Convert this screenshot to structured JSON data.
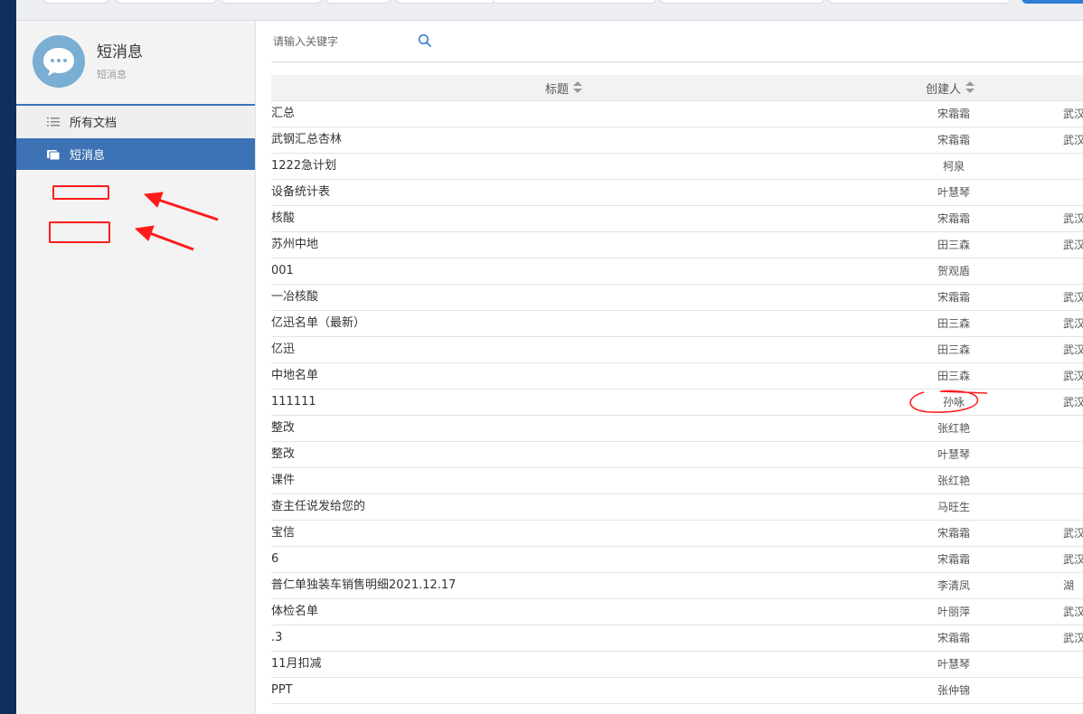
{
  "sidebar": {
    "profile": {
      "name": "短消息",
      "subtitle": "短消息",
      "avatar_icon": "chat-bubble-icon"
    },
    "menu": [
      {
        "label": "所有文档",
        "icon": "list-icon"
      },
      {
        "label": "短消息",
        "icon": "folder-icon",
        "active": true
      }
    ]
  },
  "search": {
    "placeholder": "请输入关键字",
    "value": ""
  },
  "table": {
    "headers": {
      "title": "标题",
      "creator": "创建人"
    },
    "rows": [
      {
        "title": "汇总",
        "creator": "宋霜霜",
        "dept": "武汉"
      },
      {
        "title": "武钢汇总杏林",
        "creator": "宋霜霜",
        "dept": "武汉"
      },
      {
        "title": "1222急计划",
        "creator": "柯泉",
        "dept": ""
      },
      {
        "title": "设备统计表",
        "creator": "叶慧琴",
        "dept": ""
      },
      {
        "title": "核酸",
        "creator": "宋霜霜",
        "dept": "武汉"
      },
      {
        "title": "苏州中地",
        "creator": "田三森",
        "dept": "武汉"
      },
      {
        "title": "001",
        "creator": "贺观盾",
        "dept": ""
      },
      {
        "title": "一冶核酸",
        "creator": "宋霜霜",
        "dept": "武汉"
      },
      {
        "title": "亿迅名单（最新）",
        "creator": "田三森",
        "dept": "武汉"
      },
      {
        "title": "亿迅",
        "creator": "田三森",
        "dept": "武汉"
      },
      {
        "title": "中地名单",
        "creator": "田三森",
        "dept": "武汉"
      },
      {
        "title": "111111",
        "creator": "孙咏",
        "dept": "武汉"
      },
      {
        "title": "整改",
        "creator": "张红艳",
        "dept": ""
      },
      {
        "title": "整改",
        "creator": "叶慧琴",
        "dept": ""
      },
      {
        "title": "课件",
        "creator": "张红艳",
        "dept": ""
      },
      {
        "title": "查主任说发给您的",
        "creator": "马旺生",
        "dept": ""
      },
      {
        "title": "宝信",
        "creator": "宋霜霜",
        "dept": "武汉"
      },
      {
        "title": "6",
        "creator": "宋霜霜",
        "dept": "武汉"
      },
      {
        "title": "普仁单独装车销售明细2021.12.17",
        "creator": "李清凤",
        "dept": "湖"
      },
      {
        "title": "体检名单",
        "creator": "叶丽萍",
        "dept": "武汉"
      },
      {
        "title": ".3",
        "creator": "宋霜霜",
        "dept": "武汉"
      },
      {
        "title": "11月扣减",
        "creator": "叶慧琴",
        "dept": ""
      },
      {
        "title": "PPT",
        "creator": "张仲锦",
        "dept": ""
      }
    ]
  },
  "colors": {
    "left_strip": "#0f2f5c",
    "active_menu": "#3d72b4",
    "annotation_red": "#ff1b1b"
  }
}
